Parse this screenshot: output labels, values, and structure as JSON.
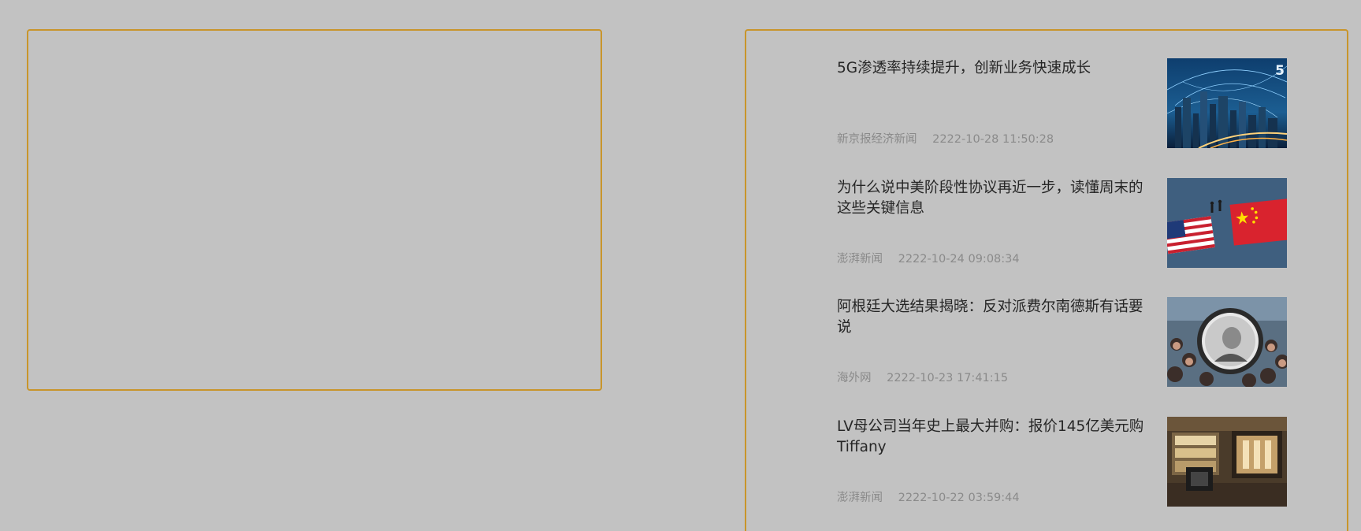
{
  "news": [
    {
      "title": "5G渗透率持续提升，创新业务快速成长",
      "source": "新京报经济新闻",
      "time": "2222-10-28 11:50:28",
      "thumb_icon": "city-network-image",
      "thumb_text": "5"
    },
    {
      "title": "为什么说中美阶段性协议再近一步，读懂周末的这些关键信息",
      "source": "澎湃新闻",
      "time": "2222-10-24 09:08:34",
      "thumb_icon": "us-china-flags-image"
    },
    {
      "title": "阿根廷大选结果揭晓：反对派费尔南德斯有话要说",
      "source": "海外网",
      "time": "2222-10-23 17:41:15",
      "thumb_icon": "election-rally-image"
    },
    {
      "title": "LV母公司当年史上最大并购：报价145亿美元购Tiffany",
      "source": "澎湃新闻",
      "time": "2222-10-22 03:59:44",
      "thumb_icon": "luxury-store-image"
    }
  ]
}
